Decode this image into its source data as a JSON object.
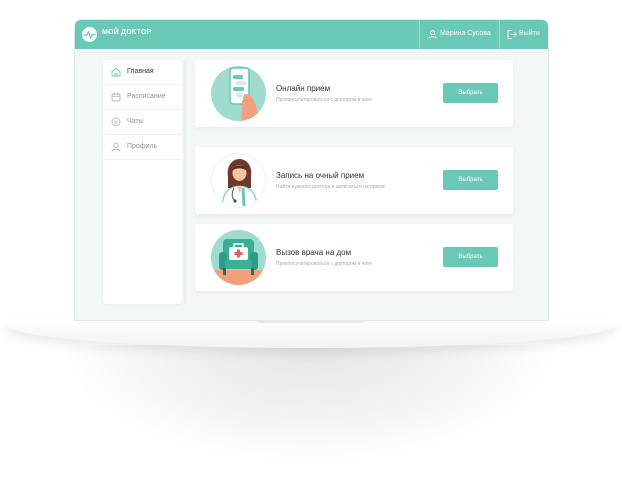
{
  "app": {
    "logo_text": "МОЙ ДОКТОР"
  },
  "header": {
    "user_name": "Марина Сусова",
    "logout_label": "Выйти"
  },
  "sidebar": {
    "items": [
      {
        "label": "Главная",
        "icon": "home-icon",
        "active": true
      },
      {
        "label": "Расписание",
        "icon": "calendar-icon",
        "active": false
      },
      {
        "label": "Чаты",
        "icon": "chat-icon",
        "active": false
      },
      {
        "label": "Профиль",
        "icon": "user-icon",
        "active": false
      }
    ]
  },
  "cards": [
    {
      "title": "Онлайн прием",
      "subtitle": "Проконсультироваться с доктором в чате",
      "button": "Выбрать",
      "illustration": "phone-chat-illustration"
    },
    {
      "title": "Запись на очный прием",
      "subtitle": "Найти нужного доктора и записаться на прием",
      "button": "Выбрать",
      "illustration": "doctor-illustration"
    },
    {
      "title": "Вызов врача на дом",
      "subtitle": "Проконсультироваться с доктором в чате",
      "button": "Выбрать",
      "illustration": "medkit-armchair-illustration"
    }
  ],
  "colors": {
    "accent": "#6ac8b6",
    "illustration_bg": "#9fdcce",
    "background": "#f3f7f6"
  }
}
